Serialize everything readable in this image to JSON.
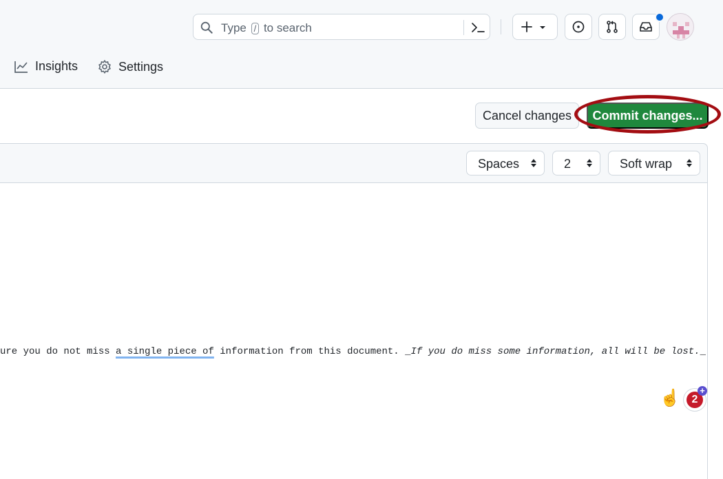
{
  "header": {
    "search": {
      "placeholder_before": "Type",
      "slash_key": "/",
      "placeholder_after": "to search"
    },
    "notification_dot_color": "#0969da"
  },
  "nav": {
    "insights": "Insights",
    "settings": "Settings"
  },
  "actions": {
    "cancel_label": "Cancel changes",
    "commit_label": "Commit changes...",
    "commit_color": "#1f883d"
  },
  "editor": {
    "indent_mode": "Spaces",
    "indent_size": "2",
    "wrap_mode": "Soft wrap",
    "line": {
      "part1": "ure you do not miss ",
      "underlined": "a single piece of",
      "part2": " information from this document. _",
      "italic": "If you do miss some information, all will be lost.",
      "part3": "_"
    }
  },
  "badge": {
    "count": "2",
    "plus": "+"
  }
}
